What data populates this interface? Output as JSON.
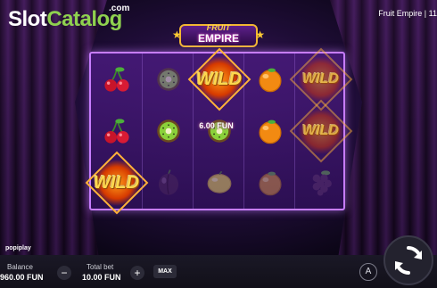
{
  "watermark": {
    "part1": "Slot",
    "part2": "Catalog",
    "suffix": ".com"
  },
  "header": {
    "game_title": "Fruit Empire | 11"
  },
  "game_logo": {
    "line1": "FRUIT",
    "line2": "EMPIRE"
  },
  "reels": {
    "columns": [
      [
        "cherry",
        "cherry",
        "wild"
      ],
      [
        "kiwi",
        "kiwi",
        "plum"
      ],
      [
        "wild",
        "kiwi",
        "lemon"
      ],
      [
        "orange",
        "orange",
        "orange"
      ],
      [
        "wild",
        "wild",
        "grapes"
      ]
    ],
    "wild_label": "WILD",
    "win_amount": "6.00 FUN"
  },
  "provider": "popiplay",
  "controls": {
    "balance_label": "Balance",
    "balance_value": "960.00 FUN",
    "total_bet_label": "Total bet",
    "total_bet_value": "10.00 FUN",
    "minus_icon": "minus-icon",
    "plus_icon": "plus-icon",
    "max_label": "MAX",
    "auto_label": "A",
    "spin_icon": "spin-icon"
  },
  "colors": {
    "accent": "#8fd14f",
    "reel_border": "#c77dff",
    "wild_gold": "#ffd84d"
  }
}
